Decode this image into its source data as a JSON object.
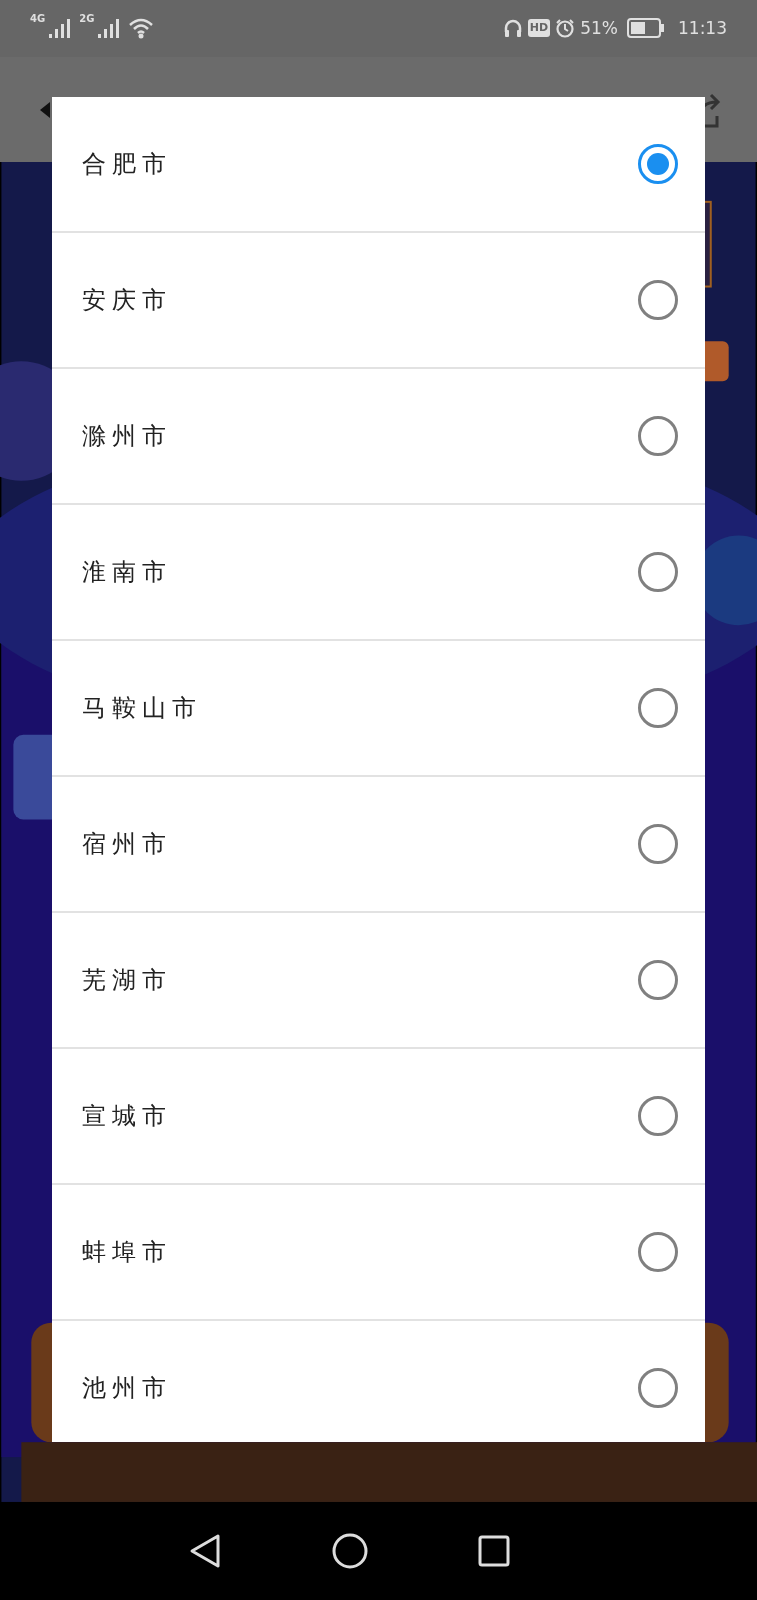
{
  "status_bar": {
    "network_1": "4G",
    "network_2": "2G",
    "hd_badge": "HD",
    "battery_percent": "51%",
    "time": "11:13"
  },
  "dialog": {
    "options": [
      {
        "label": "合肥市",
        "selected": true
      },
      {
        "label": "安庆市",
        "selected": false
      },
      {
        "label": "滁州市",
        "selected": false
      },
      {
        "label": "淮南市",
        "selected": false
      },
      {
        "label": "马鞍山市",
        "selected": false
      },
      {
        "label": "宿州市",
        "selected": false
      },
      {
        "label": "芜湖市",
        "selected": false
      },
      {
        "label": "宣城市",
        "selected": false
      },
      {
        "label": "蚌埠市",
        "selected": false
      },
      {
        "label": "池州市",
        "selected": false
      }
    ]
  }
}
